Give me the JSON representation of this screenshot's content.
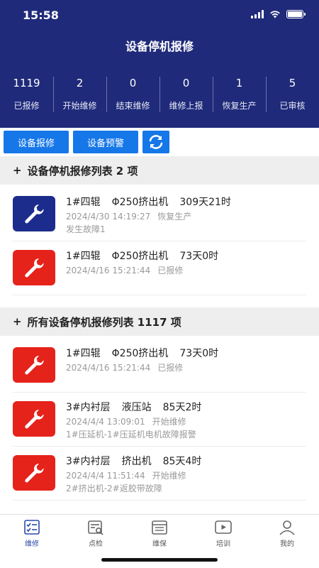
{
  "status": {
    "time": "15:58"
  },
  "header": {
    "title": "设备停机报修"
  },
  "stats": [
    {
      "value": "1119",
      "label": "已报修"
    },
    {
      "value": "2",
      "label": "开始维修"
    },
    {
      "value": "0",
      "label": "结束维修"
    },
    {
      "value": "0",
      "label": "维修上报"
    },
    {
      "value": "1",
      "label": "恢复生产"
    },
    {
      "value": "5",
      "label": "已审核"
    }
  ],
  "toolbar": {
    "report_label": "设备报修",
    "warning_label": "设备预警"
  },
  "section1": {
    "title": "设备停机报修列表 2 项",
    "items": [
      {
        "icon_color": "#1c2c8c",
        "name": "1#四辊",
        "machine": "Φ250挤出机",
        "duration": "309天21时",
        "time": "2024/4/30 14:19:27",
        "status": "恢复生产",
        "desc": "发生故障1"
      },
      {
        "icon_color": "#e5231b",
        "name": "1#四辊",
        "machine": "Φ250挤出机",
        "duration": "73天0时",
        "time": "2024/4/16 15:21:44",
        "status": "已报修",
        "desc": ""
      }
    ]
  },
  "section2": {
    "title": "所有设备停机报修列表 1117 项",
    "items": [
      {
        "icon_color": "#e5231b",
        "name": "1#四辊",
        "machine": "Φ250挤出机",
        "duration": "73天0时",
        "time": "2024/4/16 15:21:44",
        "status": "已报修",
        "desc": ""
      },
      {
        "icon_color": "#e5231b",
        "name": "3#内衬层",
        "machine": "液压站",
        "duration": "85天2时",
        "time": "2024/4/4 13:09:01",
        "status": "开始维修",
        "desc": "1#压延机-1#压延机电机故障报警"
      },
      {
        "icon_color": "#e5231b",
        "name": "3#内衬层",
        "machine": "挤出机",
        "duration": "85天4时",
        "time": "2024/4/4 11:51:44",
        "status": "开始维修",
        "desc": "2#挤出机-2#返胶带故障"
      }
    ]
  },
  "nav": [
    {
      "label": "维修",
      "icon": "checklist-icon",
      "active": true
    },
    {
      "label": "点检",
      "icon": "inspect-icon",
      "active": false
    },
    {
      "label": "维保",
      "icon": "maintenance-icon",
      "active": false
    },
    {
      "label": "培训",
      "icon": "play-icon",
      "active": false
    },
    {
      "label": "我的",
      "icon": "user-icon",
      "active": false
    }
  ]
}
